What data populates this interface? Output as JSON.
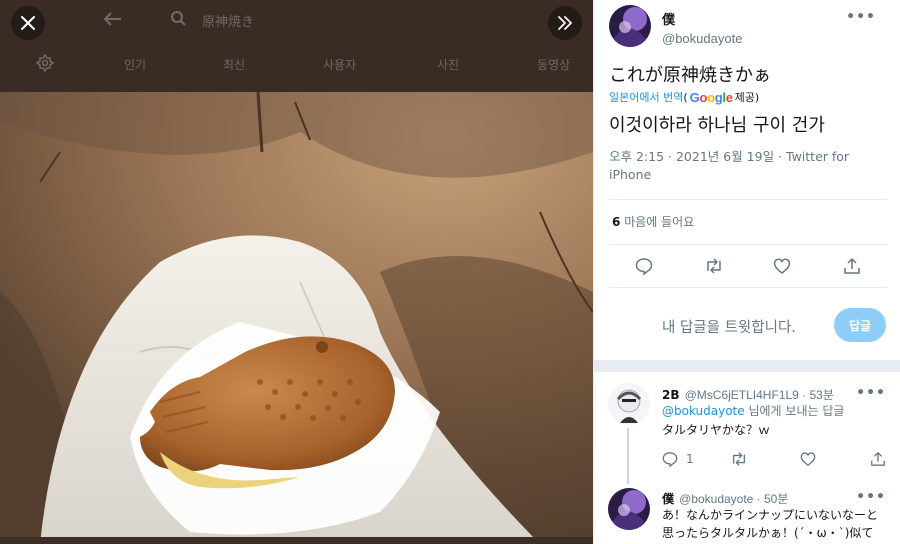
{
  "viewer": {
    "search_text": "原神焼き",
    "tabs": [
      "인기",
      "최신",
      "사용자",
      "사진",
      "동영상"
    ]
  },
  "tweet": {
    "display_name": "僕",
    "handle": "@bokudayote",
    "text": "これが原神焼きかぁ",
    "translate_label": "일본어에서 번역",
    "translate_provider_open": "(",
    "translate_provider_brand": "Google",
    "translate_provider_close": "제공)",
    "translated_text": "이것이하라 하나님 구이 건가",
    "meta": "오후 2:15 · 2021년 6월 19일 · Twitter for iPhone",
    "likes_count": "6",
    "likes_label": "마음에 들어요",
    "reply_placeholder": "내 답글을 트윗합니다.",
    "reply_button": "답글"
  },
  "replies": [
    {
      "display_name": "2B",
      "handle": "@MsC6jETLI4HF1L9 · 53분",
      "mention": "@bokudayote",
      "mention_suffix": " 님에게 보내는 답글",
      "text": "タルタリヤかな？ｗ",
      "reply_count": "1"
    },
    {
      "display_name": "僕",
      "handle": "@bokudayote · 50분",
      "text_line1": "あ！なんかラインナップにいないなーと",
      "text_line2": "思ったらタルタルかぁ！(´・ω・`)似て"
    }
  ],
  "colors": {
    "accent": "#1b95e0",
    "reply_button_bg": "#8ecdf8",
    "secondary_text": "#657786",
    "viewer_overlay": "#3c2c26"
  },
  "icons": [
    "close-icon",
    "expand-icon",
    "back-arrow-icon",
    "search-icon",
    "settings-icon",
    "more-icon",
    "reply-icon",
    "retweet-icon",
    "like-icon",
    "share-icon"
  ]
}
